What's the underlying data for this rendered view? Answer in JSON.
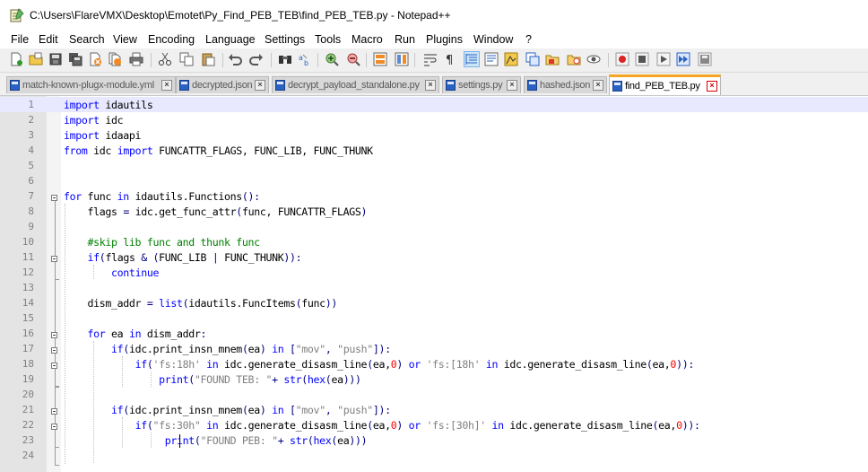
{
  "window": {
    "title": "C:\\Users\\FlareVMX\\Desktop\\Emotet\\Py_Find_PEB_TEB\\find_PEB_TEB.py - Notepad++",
    "app_icon": "notepad-plus-plus-icon"
  },
  "menu": [
    "File",
    "Edit",
    "Search",
    "View",
    "Encoding",
    "Language",
    "Settings",
    "Tools",
    "Macro",
    "Run",
    "Plugins",
    "Window",
    "?"
  ],
  "tabs": [
    {
      "label": "match-known-plugx-module.yml",
      "active": false
    },
    {
      "label": "decrypted.json",
      "active": false
    },
    {
      "label": "decrypt_payload_standalone.py",
      "active": false
    },
    {
      "label": "settings.py",
      "active": false
    },
    {
      "label": "hashed.json",
      "active": false
    },
    {
      "label": "find_PEB_TEB.py",
      "active": true
    }
  ],
  "toolbar_icons": [
    "new-file-icon",
    "open-file-icon",
    "save-icon",
    "save-all-icon",
    "close-icon",
    "close-all-icon",
    "print-icon",
    "cut-icon",
    "copy-icon",
    "paste-icon",
    "undo-icon",
    "redo-icon",
    "find-icon",
    "replace-icon",
    "zoom-in-icon",
    "zoom-out-icon",
    "sync-vertical-icon",
    "sync-horizontal-icon",
    "word-wrap-icon",
    "show-all-chars-icon",
    "indent-guide-icon",
    "user-language-icon",
    "doc-map-icon",
    "function-list-icon",
    "folder-workspace-icon",
    "monitoring-icon",
    "record-macro-icon",
    "stop-macro-icon",
    "play-macro-icon",
    "run-macro-multiple-icon",
    "save-macro-icon"
  ],
  "line_numbers": [
    "1",
    "2",
    "3",
    "4",
    "5",
    "6",
    "7",
    "8",
    "9",
    "10",
    "11",
    "12",
    "13",
    "14",
    "15",
    "16",
    "17",
    "18",
    "19",
    "20",
    "21",
    "22",
    "23",
    "24"
  ],
  "code": {
    "l1": [
      "import",
      " idautils"
    ],
    "l2": [
      "import",
      " idc"
    ],
    "l3": [
      "import",
      " idaapi"
    ],
    "l4": [
      "from",
      " idc ",
      "import",
      " FUNCATTR_FLAGS, FUNC_LIB, FUNC_THUNK"
    ],
    "l7": [
      "for",
      " func ",
      "in",
      " idautils.Functions",
      "():"
    ],
    "l8": [
      "    flags ",
      "=",
      " idc.get_func_attr",
      "(",
      "func, FUNCATTR_FLAGS",
      ")"
    ],
    "l10": [
      "    #skip lib func and thunk func"
    ],
    "l11": [
      "    ",
      "if",
      "(",
      "flags ",
      "&",
      " ",
      "(",
      "FUNC_LIB ",
      "|",
      " FUNC_THUNK",
      "))",
      ":"
    ],
    "l12": [
      "        ",
      "continue"
    ],
    "l14": [
      "    dism_addr ",
      "=",
      " ",
      "list",
      "(",
      "idautils.FuncItems",
      "(",
      "func",
      "))"
    ],
    "l16": [
      "    ",
      "for",
      " ea ",
      "in",
      " dism_addr",
      ":"
    ],
    "l17": [
      "        ",
      "if",
      "(",
      "idc.print_insn_mnem",
      "(",
      "ea",
      ")",
      " ",
      "in",
      " ",
      "[",
      "\"mov\"",
      ", ",
      "\"push\"",
      "]):"
    ],
    "l18": [
      "            ",
      "if",
      "(",
      "'fs:18h'",
      " ",
      "in",
      " idc.generate_disasm_line",
      "(",
      "ea,",
      "0",
      ")",
      " ",
      "or",
      " ",
      "'fs:[18h'",
      " ",
      "in",
      " idc.generate_disasm_line",
      "(",
      "ea,",
      "0",
      ")):"
    ],
    "l19": [
      "                ",
      "print",
      "(",
      "\"FOUND TEB: \"",
      "+",
      " ",
      "str",
      "(",
      "hex",
      "(",
      "ea",
      ")))"
    ],
    "l21": [
      "        ",
      "if",
      "(",
      "idc.print_insn_mnem",
      "(",
      "ea",
      ")",
      " ",
      "in",
      " ",
      "[",
      "\"mov\"",
      ", ",
      "\"push\"",
      "]):"
    ],
    "l22": [
      "            ",
      "if",
      "(",
      "\"fs:30h\"",
      " ",
      "in",
      " idc.generate_disasm_line",
      "(",
      "ea,",
      "0",
      ")",
      " ",
      "or",
      " ",
      "'fs:[30h]'",
      " ",
      "in",
      " idc.generate_disasm_line",
      "(",
      "ea,",
      "0",
      ")):"
    ],
    "l23": [
      "                 ",
      "print",
      "(",
      "\"FOUND PEB: \"",
      "+",
      " ",
      "str",
      "(",
      "hex",
      "(",
      "ea",
      ")))"
    ]
  },
  "colors": {
    "keyword": "#0000ff",
    "string": "#808080",
    "number": "#ff0000",
    "comment": "#008000",
    "operator": "#000080",
    "current_line": "#e8e8ff",
    "active_tab_accent": "#f5a623"
  }
}
